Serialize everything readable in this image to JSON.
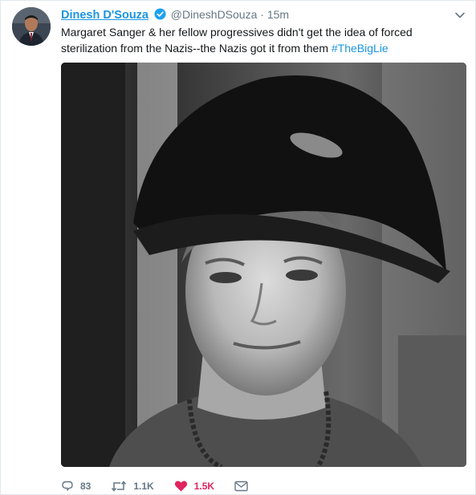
{
  "tweet": {
    "author_name": "Dinesh D'Souza",
    "handle": "@DineshDSouza",
    "separator": "·",
    "time": "15m",
    "text_main": "Margaret Sanger & her fellow progressives didn't get the idea of forced sterilization from the Nazis--the Nazis got it from them ",
    "hashtag": "#TheBigLie",
    "verified_icon": "verified-badge-icon",
    "avatar_icon": "avatar",
    "photo_icon": "tweet-photo"
  },
  "actions": {
    "replies": "83",
    "retweets": "1.1K",
    "likes": "1.5K",
    "reply_icon": "reply-icon",
    "retweet_icon": "retweet-icon",
    "like_icon": "heart-icon",
    "message_icon": "direct-message-icon"
  },
  "colors": {
    "link_blue": "#1b95e0",
    "muted": "#657786",
    "like_red": "#e0245e"
  }
}
